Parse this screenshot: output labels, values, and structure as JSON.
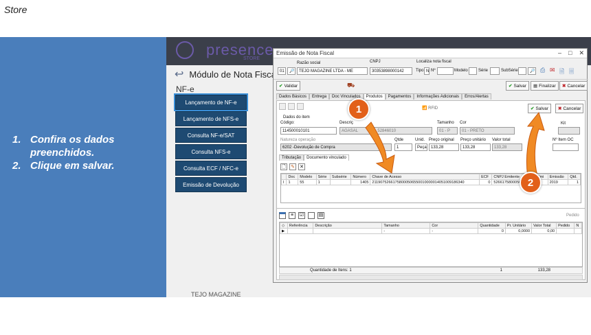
{
  "page": {
    "title": "Store"
  },
  "instructions": {
    "steps": [
      {
        "num": "1.",
        "text": "Confira os dados"
      },
      {
        "num": "",
        "text": "preenchidos."
      },
      {
        "num": "2.",
        "text": "Clique em salvar."
      }
    ]
  },
  "app": {
    "logo_text": "presence",
    "logo_sub": "STORE",
    "module_title": "Módulo de Nota Fiscal",
    "section_label": "NF-e",
    "menu": [
      "Lançamento de NF-e",
      "Lançamento de NFS-e",
      "Consulta NF-e/SAT",
      "Consulta NFS-e",
      "Consulta ECF / NFC-e",
      "Emissão de Devolução"
    ],
    "footer": "TEJO MAGAZINE"
  },
  "dialog": {
    "title": "Emissão de Nota Fiscal",
    "razao_label": "Razão social",
    "cnpj_label": "CNPJ",
    "localiza_label": "Localiza nota fiscal",
    "empresa_code": "01",
    "razao_value": "TEJO MAGAZINE LTDA - ME",
    "cnpj_value": "30353898000142",
    "tipo_label": "Tipo",
    "tipo_value": "N",
    "numero_label": "Nº",
    "modelo_label": "Modelo",
    "serie_label": "Série",
    "subserie_label": "SubSérie",
    "validar_label": "Validar",
    "salvar_label": "Salvar",
    "finalizar_label": "Finalizar",
    "cancelar_label": "Cancelar",
    "tabs": [
      "Dados Básicos",
      "Entrega",
      "Doc Vinculados",
      "Produtos",
      "Pagamentos",
      "Informações Adicionais",
      "Erros/Alertas"
    ],
    "rfid_label": "RFID",
    "salvar2_label": "Salvar",
    "cancelar2_label": "Cancelar",
    "dados_item_label": "Dados do item",
    "codigo_label": "Código:",
    "codigo_value": "114500010101",
    "descricao_label": "Descriç",
    "descricao_value": "AGASAL",
    "descricao_tail": "52846010",
    "tamanho_label": "Tamanho",
    "tamanho_value": "01 - P",
    "cor_label": "Cor",
    "cor_value": "01 - PRETO",
    "kit_label": "Kit",
    "natureza_label": "Natureza operação",
    "natureza_value": "6202 -Devolução de Compra",
    "qtde_label": "Qtde",
    "qtde_value": "1",
    "unid_label": "Unid.",
    "unid_value": "Peça",
    "preco_orig_label": "Preço original",
    "preco_orig_value": "133,28",
    "preco_unit_label": "Preço unitário",
    "preco_unit_value": "133,28",
    "valor_total_label": "Valor total",
    "valor_total_value": "133,28",
    "nitem_label": "Nº Item OC",
    "subtabs": [
      "Tributação",
      "Documento vinculado"
    ],
    "docs_headers": [
      "Doc",
      "Modelo",
      "Série",
      "Subsérie",
      "Número",
      "Chave de Acesso",
      "ECF",
      "CNPJ Emitente",
      "UF Emi",
      "Emissão",
      "Qtd."
    ],
    "docs_row": [
      "1",
      "55",
      "1",
      "",
      "1405",
      "21190752661758000506550010000014051009186340",
      "0",
      "52661758000506",
      "MA",
      "2019",
      "1"
    ],
    "pedido_label": "Pedido",
    "items_headers": [
      "Referência",
      "Descrição",
      "Tamanho",
      "Cor",
      "Quantidade",
      "Pr. Unitário",
      "Valor Total",
      "Pedido",
      "N"
    ],
    "items_row": [
      "",
      "",
      "-",
      "-",
      "0",
      "0,0000",
      "0,00",
      "",
      ""
    ],
    "footer_qty_label": "Quantidade de Itens: 1",
    "footer_qty_value": "1",
    "footer_total_value": "133,28"
  },
  "callouts": [
    "1",
    "2"
  ],
  "colors": {
    "accent_orange": "#e2601a",
    "panel_blue": "#4a7ebb",
    "menu_navy": "#1e4a72"
  }
}
